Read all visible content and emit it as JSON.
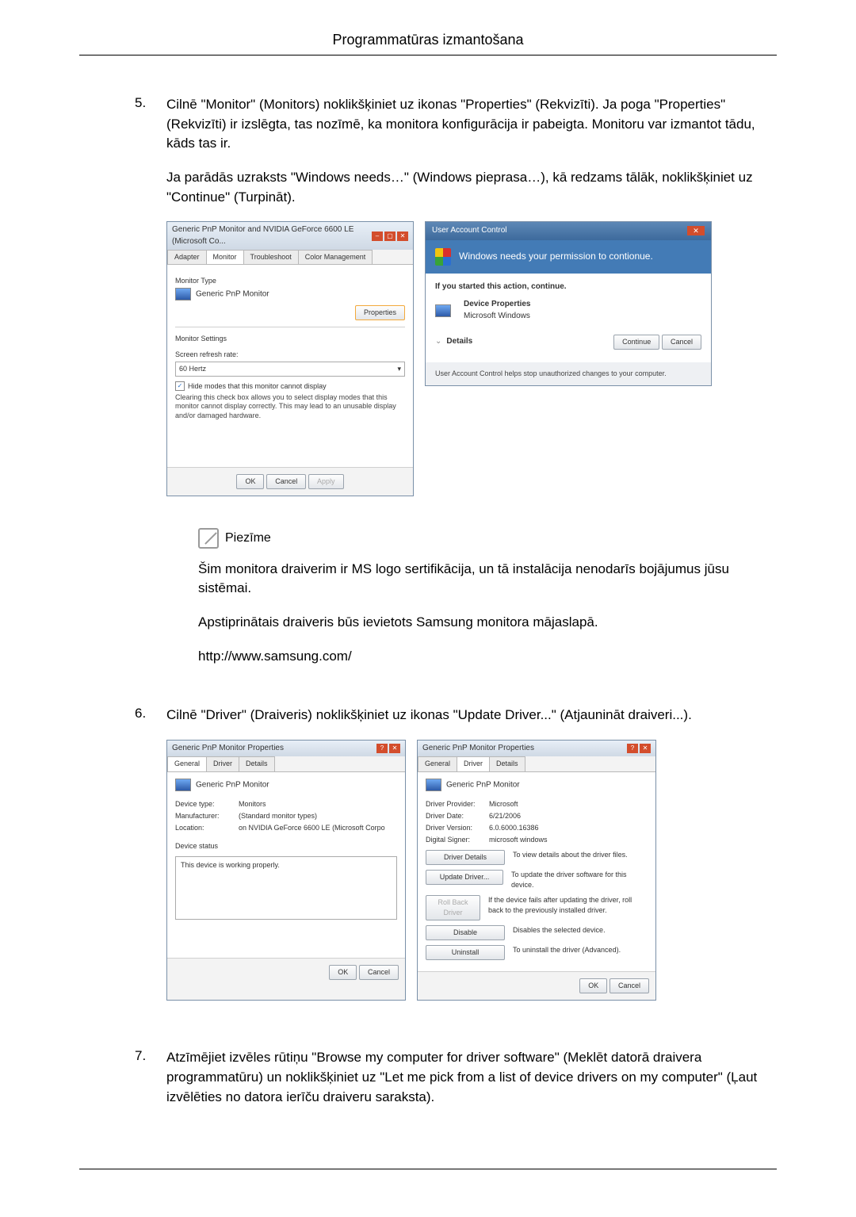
{
  "header": {
    "title": "Programmatūras izmantošana"
  },
  "step5": {
    "num": "5.",
    "p1": "Cilnē \"Monitor\" (Monitors) noklikšķiniet uz ikonas \"Properties\" (Rekvizīti). Ja poga \"Properties\" (Rekvizīti) ir izslēgta, tas nozīmē, ka monitora konfigurācija ir pabeigta. Monitoru var izmantot tādu, kāds tas ir.",
    "p2": "Ja parādās uzraksts \"Windows needs…\" (Windows pieprasa…), kā redzams tālāk, noklikšķiniet uz \"Continue\" (Turpināt)."
  },
  "win1": {
    "title": "Generic PnP Monitor and NVIDIA GeForce 6600 LE (Microsoft Co...",
    "tabs": {
      "adapter": "Adapter",
      "monitor": "Monitor",
      "troubleshoot": "Troubleshoot",
      "color": "Color Management"
    },
    "section_monitor_type": "Monitor Type",
    "monitor_name": "Generic PnP Monitor",
    "btn_properties": "Properties",
    "section_settings": "Monitor Settings",
    "refresh_label": "Screen refresh rate:",
    "refresh_value": "60 Hertz",
    "hide_modes": "Hide modes that this monitor cannot display",
    "hide_desc": "Clearing this check box allows you to select display modes that this monitor cannot display correctly. This may lead to an unusable display and/or damaged hardware.",
    "ok": "OK",
    "cancel": "Cancel",
    "apply": "Apply"
  },
  "uac": {
    "title": "User Account Control",
    "banner": "Windows needs your permission to contionue.",
    "started": "If you started this action, continue.",
    "dev_props": "Device Properties",
    "ms_windows": "Microsoft Windows",
    "details": "Details",
    "continue": "Continue",
    "cancel": "Cancel",
    "footer": "User Account Control helps stop unauthorized changes to your computer."
  },
  "note": {
    "label": "Piezīme",
    "p1": "Šim monitora draiverim ir MS logo sertifikācija, un tā instalācija nenodarīs bojājumus jūsu sistēmai.",
    "p2": "Apstiprinātais draiveris būs ievietots Samsung monitora mājaslapā.",
    "url": "http://www.samsung.com/"
  },
  "step6": {
    "num": "6.",
    "p1": "Cilnē \"Driver\" (Draiveris) noklikšķiniet uz ikonas \"Update Driver...\" (Atjaunināt draiveri...)."
  },
  "props1": {
    "title": "Generic PnP Monitor Properties",
    "tabs": {
      "general": "General",
      "driver": "Driver",
      "details": "Details"
    },
    "name": "Generic PnP Monitor",
    "devtype_k": "Device type:",
    "devtype_v": "Monitors",
    "manuf_k": "Manufacturer:",
    "manuf_v": "(Standard monitor types)",
    "loc_k": "Location:",
    "loc_v": "on NVIDIA GeForce 6600 LE (Microsoft Corpo",
    "status_label": "Device status",
    "status_text": "This device is working properly.",
    "ok": "OK",
    "cancel": "Cancel"
  },
  "props2": {
    "title": "Generic PnP Monitor Properties",
    "tabs": {
      "general": "General",
      "driver": "Driver",
      "details": "Details"
    },
    "name": "Generic PnP Monitor",
    "prov_k": "Driver Provider:",
    "prov_v": "Microsoft",
    "date_k": "Driver Date:",
    "date_v": "6/21/2006",
    "ver_k": "Driver Version:",
    "ver_v": "6.0.6000.16386",
    "sig_k": "Digital Signer:",
    "sig_v": "microsoft windows",
    "b_details": "Driver Details",
    "d_details": "To view details about the driver files.",
    "b_update": "Update Driver...",
    "d_update": "To update the driver software for this device.",
    "b_roll": "Roll Back Driver",
    "d_roll": "If the device fails after updating the driver, roll back to the previously installed driver.",
    "b_disable": "Disable",
    "d_disable": "Disables the selected device.",
    "b_uninst": "Uninstall",
    "d_uninst": "To uninstall the driver (Advanced).",
    "ok": "OK",
    "cancel": "Cancel"
  },
  "step7": {
    "num": "7.",
    "p1": "Atzīmējiet izvēles rūtiņu \"Browse my computer for driver software\" (Meklēt datorā draivera programmatūru) un noklikšķiniet uz \"Let me pick from a list of device drivers on my computer\" (Ļaut izvēlēties no datora ierīču draiveru saraksta)."
  }
}
